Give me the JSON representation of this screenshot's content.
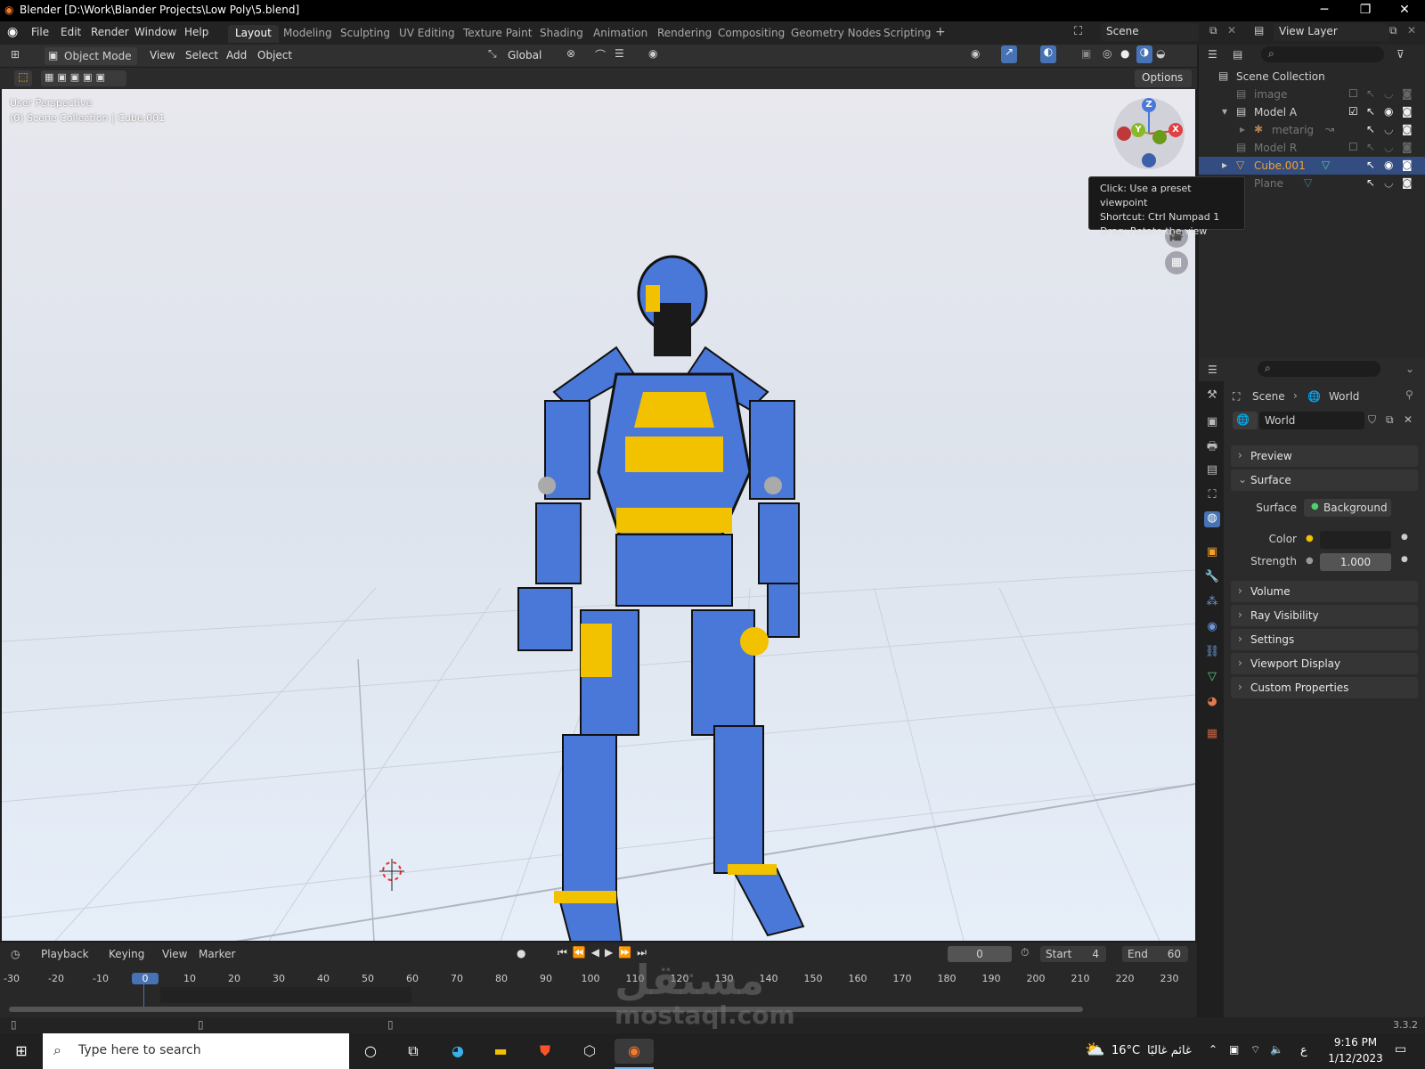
{
  "window": {
    "title": "Blender [D:\\Work\\Blander Projects\\Low Poly\\5.blend]"
  },
  "menu": [
    "File",
    "Edit",
    "Render",
    "Window",
    "Help"
  ],
  "workspaces": [
    "Layout",
    "Modeling",
    "Sculpting",
    "UV Editing",
    "Texture Paint",
    "Shading",
    "Animation",
    "Rendering",
    "Compositing",
    "Geometry Nodes",
    "Scripting"
  ],
  "scene_field": "Scene",
  "view_layer_field": "View Layer",
  "header": {
    "mode": "Object Mode",
    "view": "View",
    "select": "Select",
    "add": "Add",
    "object": "Object",
    "orientation": "Global",
    "options": "Options"
  },
  "viewport": {
    "perspective": "User Perspective",
    "collection": "(0) Scene Collection | Cube.001"
  },
  "gizmo": {
    "z": "Z",
    "y": "Y",
    "x": "X"
  },
  "tooltip": {
    "line1": "Click: Use a preset viewpoint",
    "line2": "Shortcut: Ctrl Numpad 1",
    "line3": "Drag: Rotate the view"
  },
  "outliner": {
    "root": "Scene Collection",
    "items": [
      "image",
      "Model A",
      "metarig",
      "Model R",
      "Cube.001",
      "Plane"
    ]
  },
  "properties": {
    "breadcrumb_scene": "Scene",
    "breadcrumb_world": "World",
    "world_name": "World",
    "panels": [
      "Preview",
      "Surface",
      "Volume",
      "Ray Visibility",
      "Settings",
      "Viewport Display",
      "Custom Properties"
    ],
    "surface_label": "Surface",
    "surface_value": "Background",
    "color_label": "Color",
    "strength_label": "Strength",
    "strength_value": "1.000"
  },
  "timeline": {
    "playback": "Playback",
    "keying": "Keying",
    "view": "View",
    "marker": "Marker",
    "current_frame": "0",
    "start_label": "Start",
    "start_value": "4",
    "end_label": "End",
    "end_value": "60",
    "ticks": [
      "-30",
      "-20",
      "-10",
      "0",
      "10",
      "20",
      "30",
      "40",
      "50",
      "60",
      "70",
      "80",
      "90",
      "100",
      "110",
      "120",
      "130",
      "140",
      "150",
      "160",
      "170",
      "180",
      "190",
      "200",
      "210",
      "220",
      "230"
    ]
  },
  "status": {
    "version": "3.3.2"
  },
  "taskbar": {
    "search_placeholder": "Type here to search",
    "temperature": "16°C",
    "weather": "غائم غالبًا",
    "lang": "ع",
    "time": "9:16 PM",
    "date": "1/12/2023"
  },
  "watermark": {
    "arabic": "مستقل",
    "latin": "mostaql.com"
  },
  "colors": {
    "accent": "#4772b3",
    "selected_row": "#334d80",
    "robot_blue": "#4a78d8",
    "robot_yellow": "#f2c200"
  }
}
